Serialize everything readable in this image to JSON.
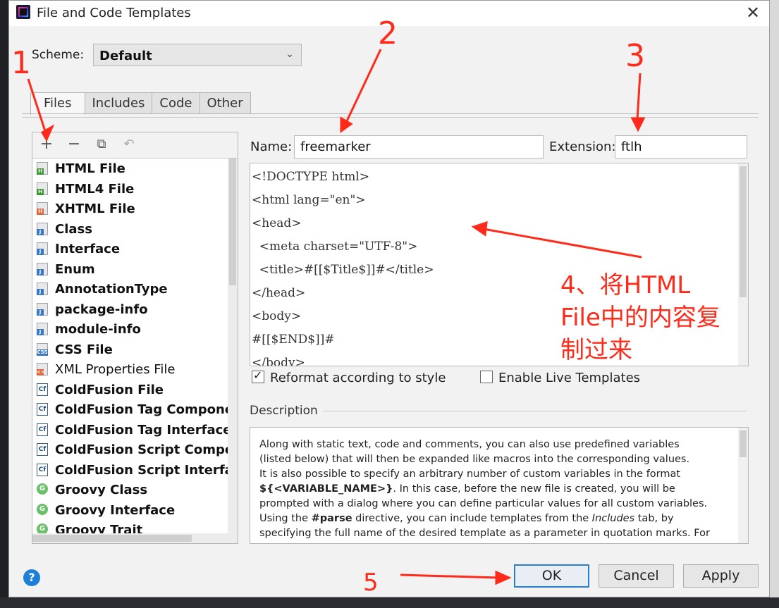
{
  "window": {
    "title": "File and Code Templates"
  },
  "scheme": {
    "label": "Scheme:",
    "value": "Default"
  },
  "tabs": [
    {
      "label": "Files",
      "active": true
    },
    {
      "label": "Includes",
      "active": false
    },
    {
      "label": "Code",
      "active": false
    },
    {
      "label": "Other",
      "active": false
    }
  ],
  "toolbar": {
    "add": "add-icon",
    "remove": "remove-icon",
    "copy": "copy-icon",
    "reset": "reset-icon"
  },
  "templates": [
    {
      "label": "HTML File",
      "icon": "html-file-icon"
    },
    {
      "label": "HTML4 File",
      "icon": "html-file-icon"
    },
    {
      "label": "XHTML File",
      "icon": "xhtml-file-icon"
    },
    {
      "label": "Class",
      "icon": "java-file-icon"
    },
    {
      "label": "Interface",
      "icon": "java-file-icon"
    },
    {
      "label": "Enum",
      "icon": "java-file-icon"
    },
    {
      "label": "AnnotationType",
      "icon": "java-file-icon"
    },
    {
      "label": "package-info",
      "icon": "java-file-icon"
    },
    {
      "label": "module-info",
      "icon": "java-file-icon"
    },
    {
      "label": "CSS File",
      "icon": "css-file-icon"
    },
    {
      "label": "XML Properties File",
      "icon": "xml-file-icon"
    },
    {
      "label": "ColdFusion File",
      "icon": "coldfusion-icon"
    },
    {
      "label": "ColdFusion Tag Component",
      "icon": "coldfusion-icon"
    },
    {
      "label": "ColdFusion Tag Interface",
      "icon": "coldfusion-icon"
    },
    {
      "label": "ColdFusion Script Componer",
      "icon": "coldfusion-icon"
    },
    {
      "label": "ColdFusion Script Interface",
      "icon": "coldfusion-icon"
    },
    {
      "label": "Groovy Class",
      "icon": "groovy-icon"
    },
    {
      "label": "Groovy Interface",
      "icon": "groovy-icon"
    },
    {
      "label": "Groovy Trait",
      "icon": "groovy-icon"
    }
  ],
  "form": {
    "name_label": "Name:",
    "name_value": "freemarker",
    "extension_label": "Extension:",
    "extension_value": "ftlh"
  },
  "code_lines": [
    "<!DOCTYPE html>",
    "<html lang=\"en\">",
    "<head>",
    "  <meta charset=\"UTF-8\">",
    "  <title>#[[$Title$]]#</title>",
    "</head>",
    "<body>",
    "#[[$END$]]#",
    "</body>"
  ],
  "options": {
    "reformat_label": "Reformat according to style",
    "reformat_checked": true,
    "live_templates_label": "Enable Live Templates",
    "live_templates_checked": false
  },
  "description": {
    "label": "Description",
    "line1": "Along with static text, code and comments, you can also use predefined variables",
    "line2": "(listed below) that will then be expanded like macros into the corresponding values.",
    "line3": "It is also possible to specify an arbitrary number of custom variables in the format",
    "line4_bold": "${<VARIABLE_NAME>}",
    "line4_rest": ". In this case, before the new file is created, you will be",
    "line5": "prompted with a dialog where you can define particular values for all custom variables.",
    "line6_a": "Using the ",
    "line6_bold": "#parse",
    "line6_b": " directive, you can include templates from the ",
    "line6_italic": "Includes",
    "line6_c": " tab, by",
    "line7": "specifying the full name of the desired template as a parameter in quotation marks. For"
  },
  "buttons": {
    "help": "?",
    "ok": "OK",
    "cancel": "Cancel",
    "apply": "Apply"
  },
  "annotations": {
    "n1": "1",
    "n2": "2",
    "n3": "3",
    "n5": "5",
    "note4_line1": "4、将HTML",
    "note4_line2": "File中的内容复",
    "note4_line3": "制过来",
    "color": "#ff2a1a"
  }
}
